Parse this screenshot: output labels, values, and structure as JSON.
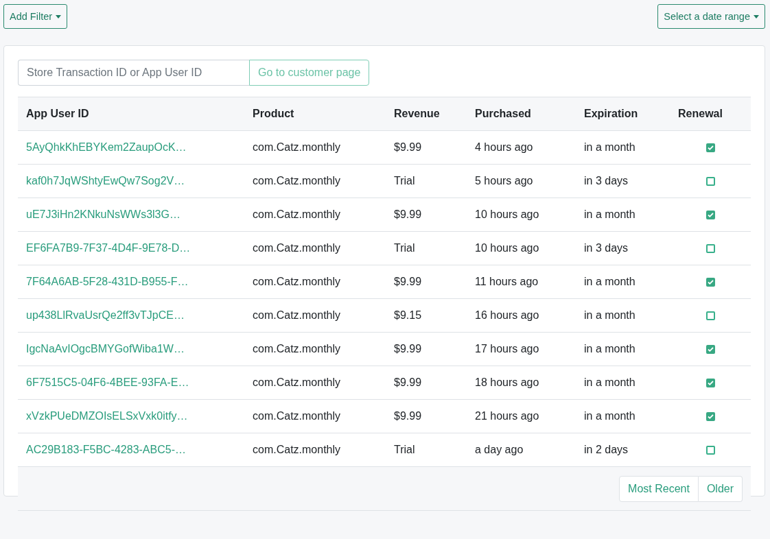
{
  "toolbar": {
    "filter_button": "Add Filter",
    "date_button": "Select a date range"
  },
  "search": {
    "placeholder": "Store Transaction ID or App User ID",
    "button": "Go to customer page"
  },
  "table": {
    "columns": [
      "App User ID",
      "Product",
      "Revenue",
      "Purchased",
      "Expiration",
      "Renewal"
    ],
    "rows": [
      {
        "app_user_id": "5AyQhkKhEBYKem2ZaupOcK…",
        "product": "com.Catz.monthly",
        "revenue": "$9.99",
        "purchased": "4 hours ago",
        "expiration": "in a month",
        "renewal": true
      },
      {
        "app_user_id": "kaf0h7JqWShtyEwQw7Sog2V…",
        "product": "com.Catz.monthly",
        "revenue": "Trial",
        "purchased": "5 hours ago",
        "expiration": "in 3 days",
        "renewal": false
      },
      {
        "app_user_id": "uE7J3iHn2KNkuNsWWs3l3G…",
        "product": "com.Catz.monthly",
        "revenue": "$9.99",
        "purchased": "10 hours ago",
        "expiration": "in a month",
        "renewal": true
      },
      {
        "app_user_id": "EF6FA7B9-7F37-4D4F-9E78-D…",
        "product": "com.Catz.monthly",
        "revenue": "Trial",
        "purchased": "10 hours ago",
        "expiration": "in 3 days",
        "renewal": false
      },
      {
        "app_user_id": "7F64A6AB-5F28-431D-B955-F…",
        "product": "com.Catz.monthly",
        "revenue": "$9.99",
        "purchased": "11 hours ago",
        "expiration": "in a month",
        "renewal": true
      },
      {
        "app_user_id": "up438LlRvaUsrQe2ff3vTJpCE…",
        "product": "com.Catz.monthly",
        "revenue": "$9.15",
        "purchased": "16 hours ago",
        "expiration": "in a month",
        "renewal": false
      },
      {
        "app_user_id": "IgcNaAvIOgcBMYGofWiba1W…",
        "product": "com.Catz.monthly",
        "revenue": "$9.99",
        "purchased": "17 hours ago",
        "expiration": "in a month",
        "renewal": true
      },
      {
        "app_user_id": "6F7515C5-04F6-4BEE-93FA-E…",
        "product": "com.Catz.monthly",
        "revenue": "$9.99",
        "purchased": "18 hours ago",
        "expiration": "in a month",
        "renewal": true
      },
      {
        "app_user_id": "xVzkPUeDMZOIsELSxVxk0itfy…",
        "product": "com.Catz.monthly",
        "revenue": "$9.99",
        "purchased": "21 hours ago",
        "expiration": "in a month",
        "renewal": true
      },
      {
        "app_user_id": "AC29B183-F5BC-4283-ABC5-…",
        "product": "com.Catz.monthly",
        "revenue": "Trial",
        "purchased": "a day ago",
        "expiration": "in 2 days",
        "renewal": false
      }
    ]
  },
  "pagination": [
    {
      "label": "Most Recent"
    },
    {
      "label": "Older"
    }
  ]
}
